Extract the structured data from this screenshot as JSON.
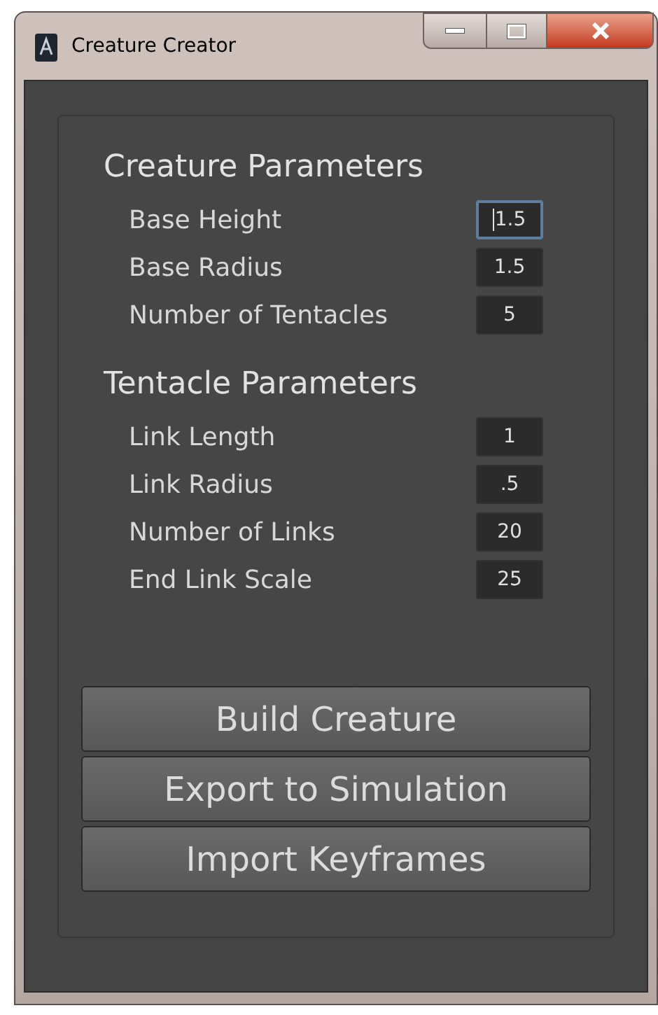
{
  "window": {
    "title": "Creature Creator"
  },
  "sections": [
    {
      "title": "Creature Parameters",
      "fields": [
        {
          "label": "Base Height",
          "value": "1.5",
          "focused": true
        },
        {
          "label": "Base Radius",
          "value": "1.5",
          "focused": false
        },
        {
          "label": "Number of Tentacles",
          "value": "5",
          "focused": false
        }
      ]
    },
    {
      "title": "Tentacle Parameters",
      "fields": [
        {
          "label": "Link Length",
          "value": "1",
          "focused": false
        },
        {
          "label": "Link Radius",
          "value": ".5",
          "focused": false
        },
        {
          "label": "Number of Links",
          "value": "20",
          "focused": false
        },
        {
          "label": "End Link Scale",
          "value": "25",
          "focused": false
        }
      ]
    }
  ],
  "buttons": [
    "Build Creature",
    "Export to Simulation",
    "Import Keyframes"
  ]
}
